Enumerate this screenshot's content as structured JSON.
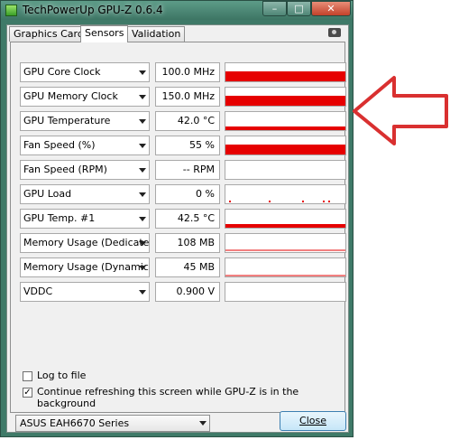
{
  "window": {
    "title": "TechPowerUp GPU-Z 0.6.4"
  },
  "tabs": [
    {
      "label": "Graphics Card"
    },
    {
      "label": "Sensors"
    },
    {
      "label": "Validation"
    }
  ],
  "sensors": [
    {
      "name": "GPU Core Clock",
      "value": "100.0 MHz",
      "graph_level": 0.55,
      "graph_style": "bar"
    },
    {
      "name": "GPU Memory Clock",
      "value": "150.0 MHz",
      "graph_level": 0.55,
      "graph_style": "bar"
    },
    {
      "name": "GPU Temperature",
      "value": "42.0 °C",
      "graph_level": 0.2,
      "graph_style": "bar"
    },
    {
      "name": "Fan Speed (%)",
      "value": "55 %",
      "graph_level": 0.55,
      "graph_style": "bar"
    },
    {
      "name": "Fan Speed (RPM)",
      "value": "-- RPM",
      "graph_level": 0,
      "graph_style": "none"
    },
    {
      "name": "GPU Load",
      "value": "0 %",
      "graph_level": 0.05,
      "graph_style": "spikes"
    },
    {
      "name": "GPU Temp. #1",
      "value": "42.5 °C",
      "graph_level": 0.2,
      "graph_style": "bar"
    },
    {
      "name": "Memory Usage (Dedicated)",
      "value": "108 MB",
      "graph_level": 0.08,
      "graph_style": "line"
    },
    {
      "name": "Memory Usage (Dynamic)",
      "value": "45 MB",
      "graph_level": 0.05,
      "graph_style": "line"
    },
    {
      "name": "VDDC",
      "value": "0.900 V",
      "graph_level": 0,
      "graph_style": "none"
    }
  ],
  "options": {
    "log_to_file": {
      "label": "Log to file",
      "checked": false
    },
    "continue_refreshing": {
      "label": "Continue refreshing this screen while GPU-Z is in the background",
      "checked": true
    }
  },
  "footer": {
    "card_select": "ASUS EAH6670 Series",
    "close_label": "Close"
  },
  "colors": {
    "graph": "#e60000",
    "arrow": "#d93030"
  },
  "annotation": {
    "arrow_direction": "left"
  }
}
